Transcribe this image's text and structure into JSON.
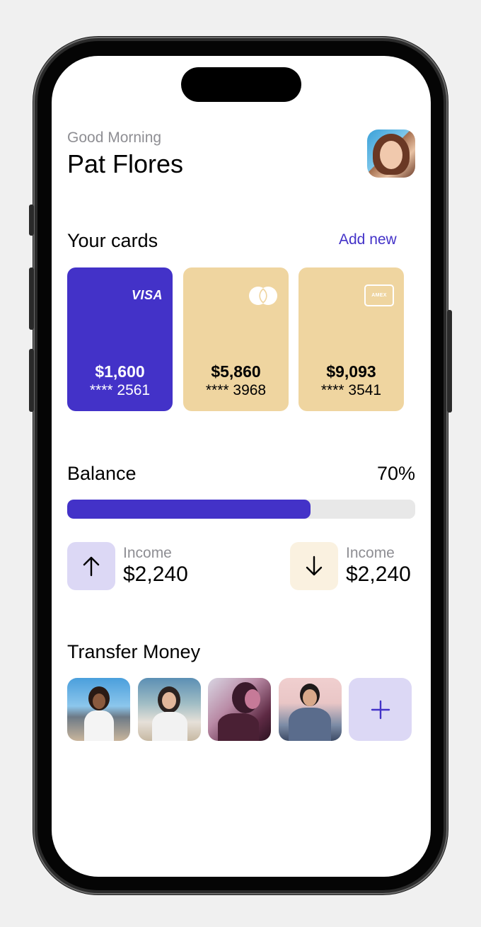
{
  "header": {
    "greeting": "Good Morning",
    "name": "Pat Flores"
  },
  "cards_section": {
    "title": "Your cards",
    "add_label": "Add new",
    "cards": [
      {
        "brand": "VISA",
        "amount": "$1,600",
        "number": "**** 2561",
        "color": "#4332c8"
      },
      {
        "brand": "mastercard-logo",
        "amount": "$5,860",
        "number": "**** 3968",
        "color": "#efd5a0"
      },
      {
        "brand": "AMEX",
        "amount": "$9,093",
        "number": "**** 3541",
        "color": "#efd5a0"
      }
    ]
  },
  "balance": {
    "label": "Balance",
    "percent_label": "70%",
    "progress_fraction": 0.7,
    "flows": [
      {
        "icon": "arrow-up-icon",
        "label": "Income",
        "amount": "$2,240"
      },
      {
        "icon": "arrow-down-icon",
        "label": "Income",
        "amount": "$2,240"
      }
    ]
  },
  "transfer": {
    "title": "Transfer Money",
    "contacts": [
      "contact-photo-1",
      "contact-photo-2",
      "contact-photo-3",
      "contact-photo-4"
    ],
    "add_icon": "plus-icon"
  },
  "colors": {
    "accent": "#4332c8",
    "accent_light": "#dcd8f5",
    "gold": "#efd5a0",
    "cream": "#faf1e0"
  }
}
